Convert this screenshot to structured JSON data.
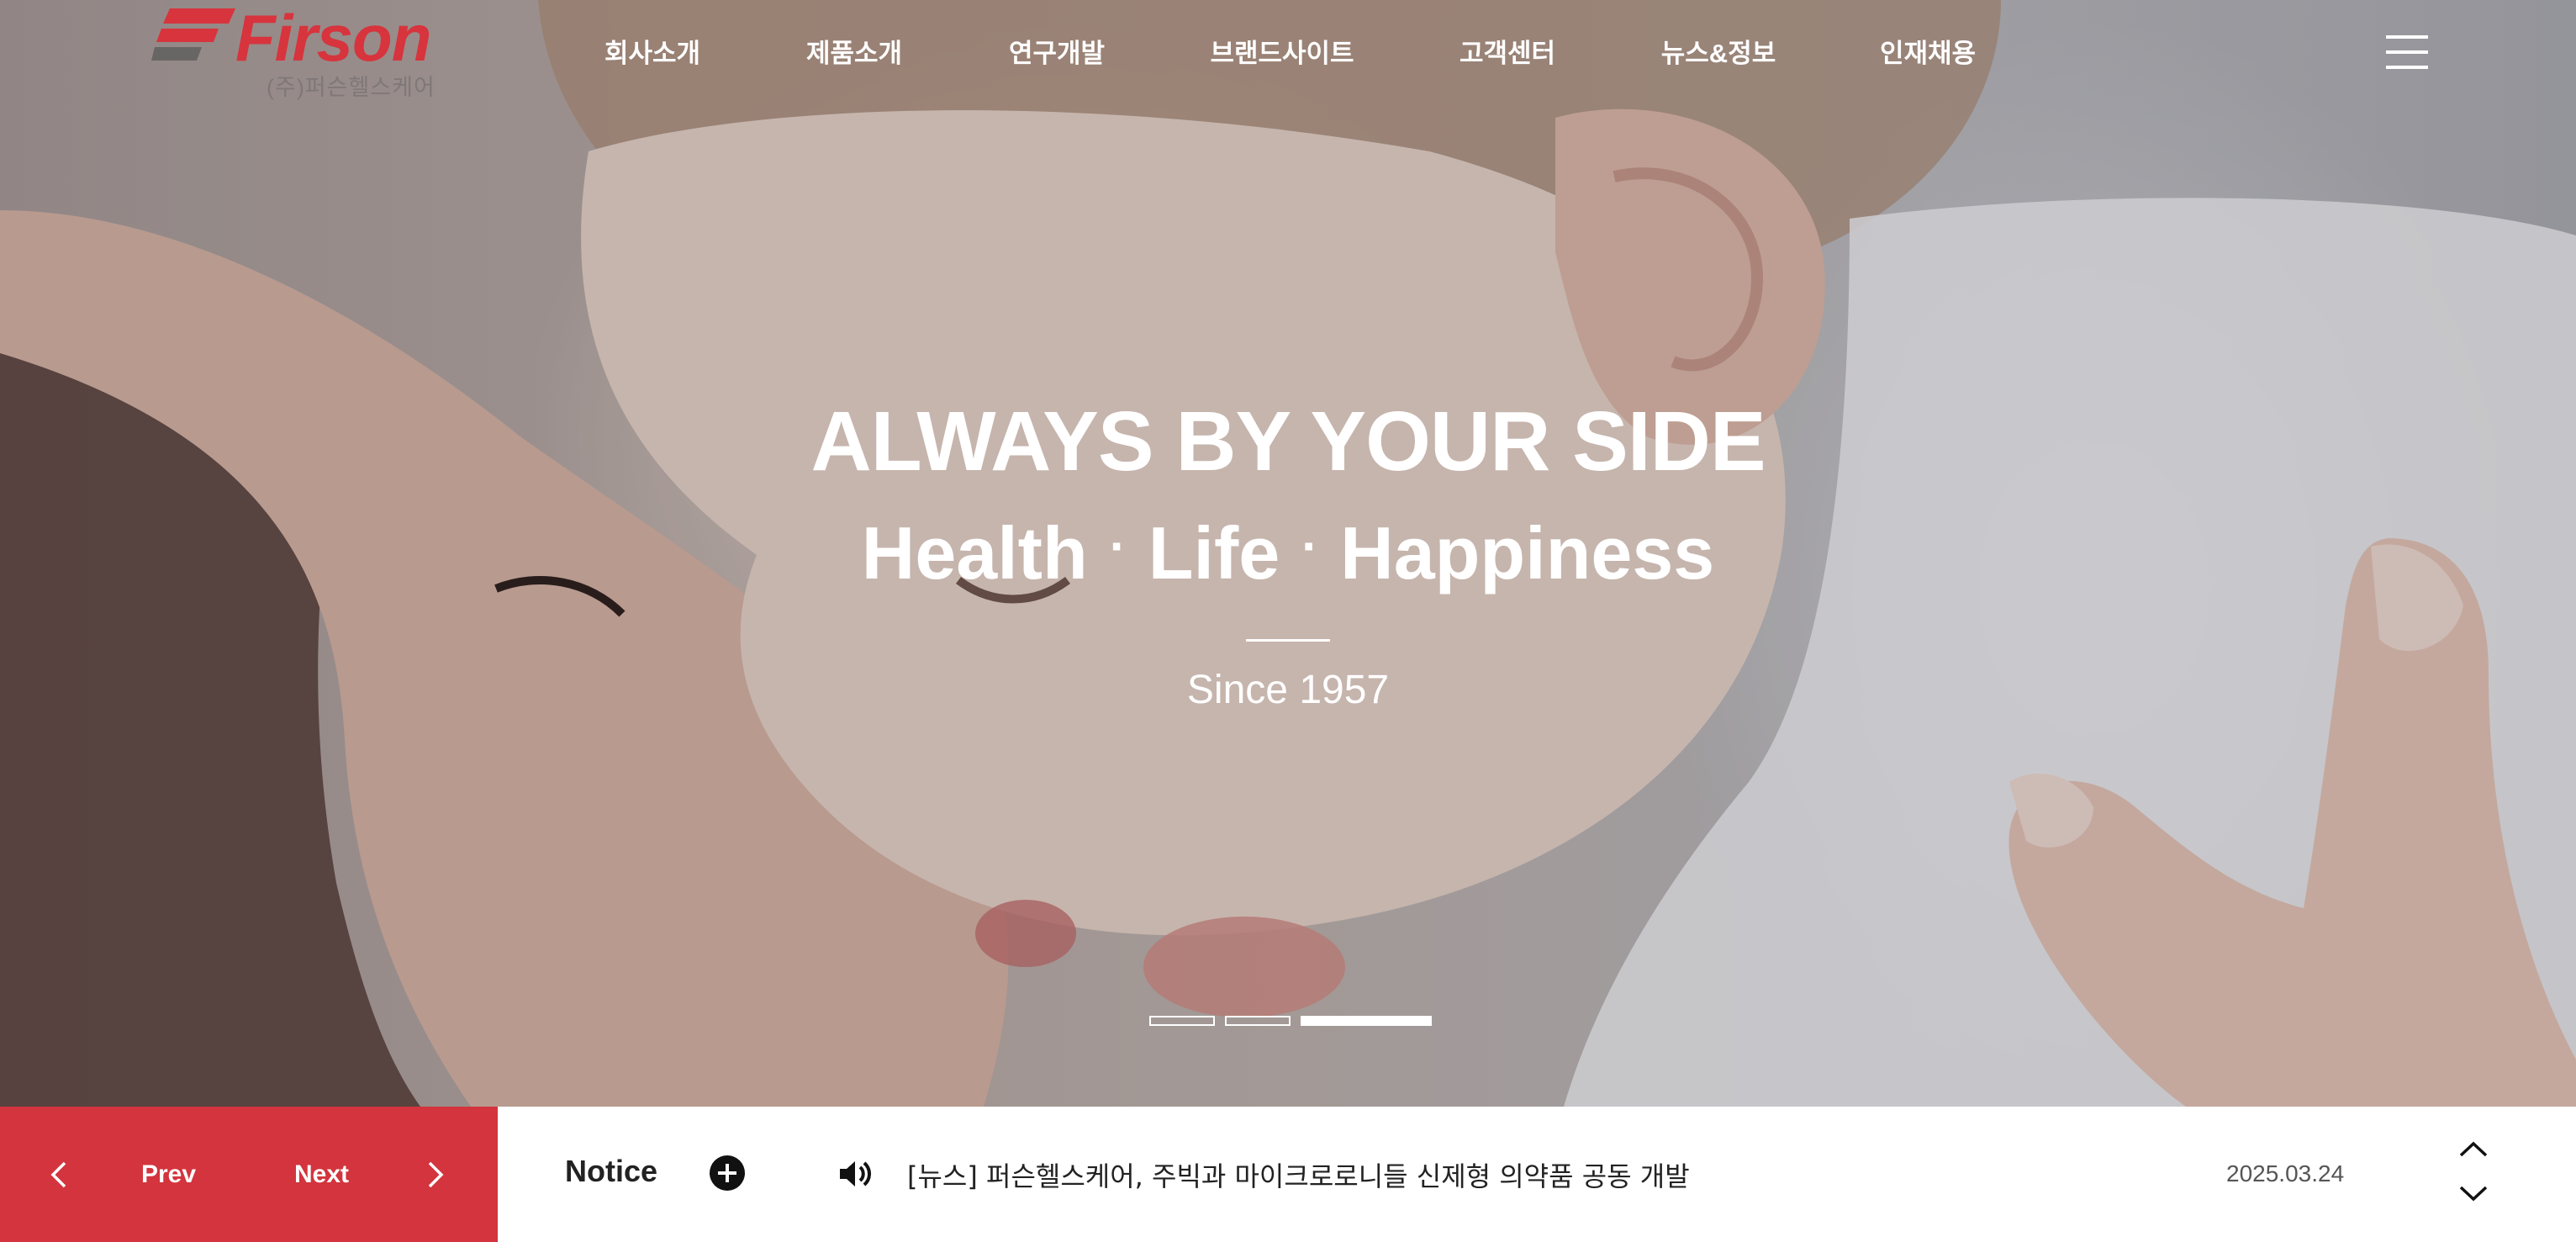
{
  "colors": {
    "brand": "#d3343d",
    "white": "#ffffff",
    "text_dark": "#222222"
  },
  "logo": {
    "name": "Firson",
    "sub": "(주)퍼슨헬스케어"
  },
  "nav": {
    "items": [
      "회사소개",
      "제품소개",
      "연구개발",
      "브랜드사이트",
      "고객센터",
      "뉴스&정보",
      "인재채용"
    ],
    "menu_icon": "hamburger-icon"
  },
  "hero": {
    "headline": "ALWAYS BY YOUR SIDE",
    "words": [
      "Health",
      "Life",
      "Happiness"
    ],
    "separator": "·",
    "since": "Since 1957",
    "slides": {
      "count": 3,
      "active": 3
    }
  },
  "controls": {
    "prev": "Prev",
    "next": "Next",
    "prev_icon": "chevron-left-icon",
    "next_icon": "chevron-right-icon"
  },
  "notice": {
    "title": "Notice",
    "more_icon": "plus-circle-icon",
    "speaker_icon": "speaker-icon",
    "text": "[뉴스] 퍼슨헬스케어, 주빅과 마이크로로니들 신제형 의약품 공동 개발",
    "date": "2025.03.24"
  }
}
